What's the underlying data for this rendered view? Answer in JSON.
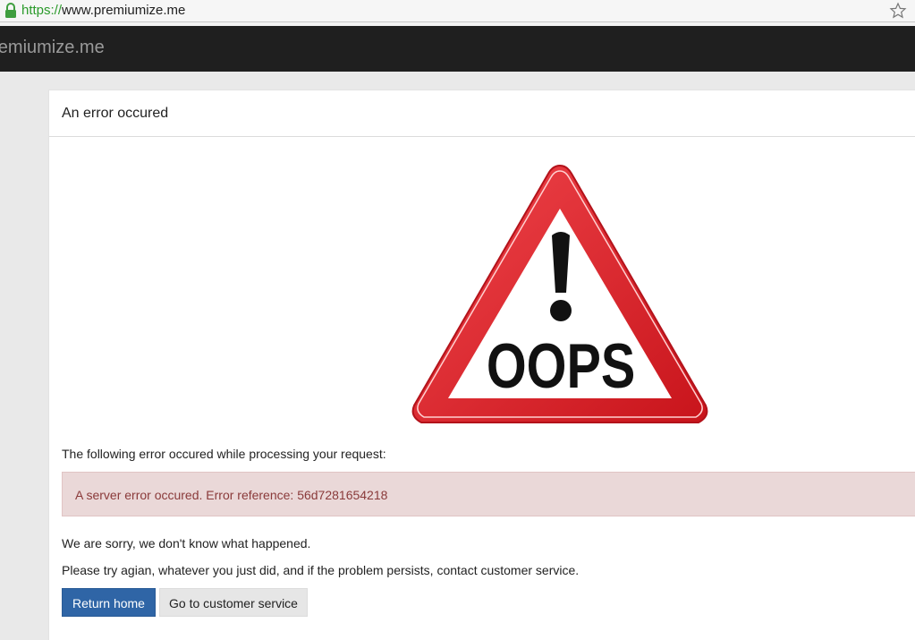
{
  "browser": {
    "url_scheme": "https://",
    "url_rest": "www.premiumize.me",
    "icons": [
      "lock-icon",
      "bookmark-star-icon"
    ]
  },
  "navbar": {
    "brand": "premiumize.me"
  },
  "panel": {
    "heading": "An error occured"
  },
  "illustration": {
    "text": "OOPS",
    "colors": {
      "triangle": "#e02027",
      "inner": "#ffffff",
      "mark": "#111111"
    }
  },
  "content": {
    "intro": "The following error occured while processing your request:",
    "alert_message": "A server error occured. Error reference: 56d7281654218",
    "apology": "We are sorry, we don't know what happened.",
    "instructions": "Please try agian, whatever you just did, and if the problem persists, contact customer service."
  },
  "buttons": {
    "return_home": "Return home",
    "customer_service": "Go to customer service"
  },
  "colors": {
    "primary_button": "#2f65a6",
    "alert_background": "#ead8d8",
    "alert_text": "#8a3a3a",
    "navbar": "#1f1f1f"
  }
}
